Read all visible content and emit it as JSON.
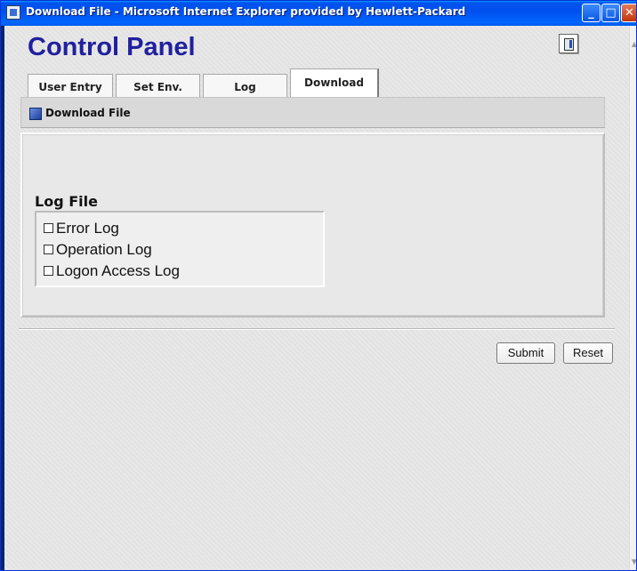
{
  "window": {
    "title": "Download File - Microsoft Internet Explorer provided by Hewlett-Packard",
    "minimize_glyph": "_",
    "maximize_glyph": "□",
    "close_glyph": "✕"
  },
  "page": {
    "title": "Control Panel",
    "logout_icon": "logout-door-icon"
  },
  "tabs": [
    {
      "label": "User Entry",
      "active": false
    },
    {
      "label": "Set Env.",
      "active": false
    },
    {
      "label": "Log",
      "active": false
    },
    {
      "label": "Download",
      "active": true
    }
  ],
  "section": {
    "header_label": "Download File",
    "group_title": "Log File",
    "options": [
      {
        "label": "Error Log",
        "checked": false
      },
      {
        "label": "Operation Log",
        "checked": false
      },
      {
        "label": "Logon Access Log",
        "checked": false
      }
    ]
  },
  "buttons": {
    "submit": "Submit",
    "reset": "Reset"
  },
  "colors": {
    "title_blue": "#2020a0",
    "titlebar": "#0053ee"
  }
}
